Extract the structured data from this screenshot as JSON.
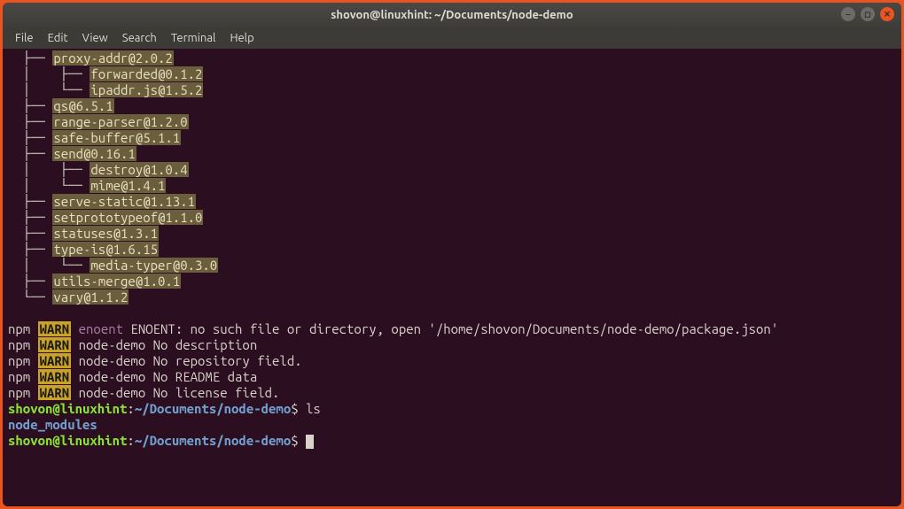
{
  "window": {
    "title": "shovon@linuxhint: ~/Documents/node-demo"
  },
  "menu": {
    "file": "File",
    "edit": "Edit",
    "view": "View",
    "search": "Search",
    "terminal": "Terminal",
    "help": "Help"
  },
  "tree": {
    "l1": "  ├── ",
    "d1": "proxy-addr@2.0.2",
    "l2": "  │    ├── ",
    "d2": "forwarded@0.1.2",
    "l3": "  │    └── ",
    "d3": "ipaddr.js@1.5.2",
    "l4": "  ├── ",
    "d4": "qs@6.5.1",
    "l5": "  ├── ",
    "d5": "range-parser@1.2.0",
    "l6": "  ├── ",
    "d6": "safe-buffer@5.1.1",
    "l7": "  ├── ",
    "d7": "send@0.16.1",
    "l8": "  │    ├── ",
    "d8": "destroy@1.0.4",
    "l9": "  │    └── ",
    "d9": "mime@1.4.1",
    "l10": "  ├── ",
    "d10": "serve-static@1.13.1",
    "l11": "  ├── ",
    "d11": "setprototypeof@1.1.0",
    "l12": "  ├── ",
    "d12": "statuses@1.3.1",
    "l13": "  ├── ",
    "d13": "type-is@1.6.15",
    "l14": "  │    └── ",
    "d14": "media-typer@0.3.0",
    "l15": "  ├── ",
    "d15": "utils-merge@1.0.1",
    "l16": "  └── ",
    "d16": "vary@1.1.2"
  },
  "warnings": {
    "npm": "npm",
    "warn": "WARN",
    "space": " ",
    "enoent1": "enoent",
    "enoent2": " ENOENT: no such file or directory, open '/home/shovon/Documents/node-demo/package.json'",
    "w2": " node-demo No description",
    "w3": " node-demo No repository field.",
    "w4": " node-demo No README data",
    "w5": " node-demo No license field."
  },
  "prompt": {
    "user": "shovon@linuxhint",
    "colon": ":",
    "path": "~/Documents/node-demo",
    "dollar": "$ ",
    "cmd_ls": "ls"
  },
  "listing": {
    "node_modules": "node_modules"
  }
}
